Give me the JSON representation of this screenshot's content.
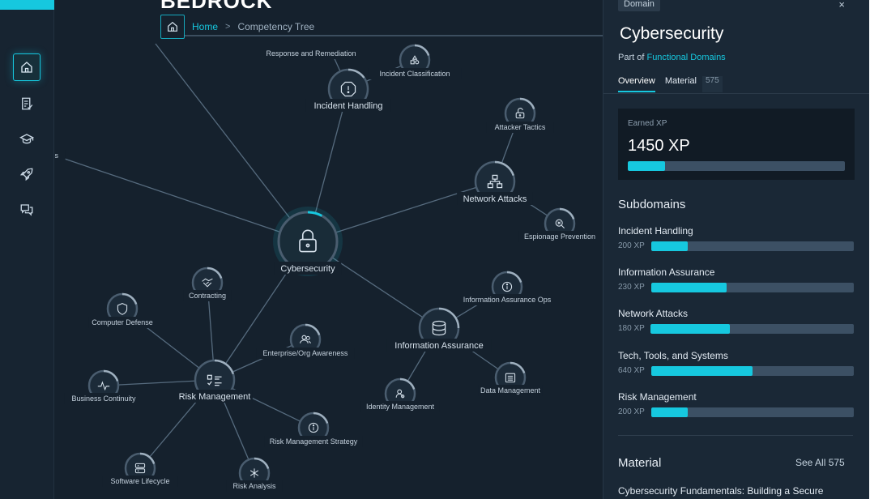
{
  "app": {
    "brand": "BEDROCK"
  },
  "breadcrumb": {
    "home": "Home",
    "separator": ">",
    "current": "Competency Tree"
  },
  "sidebar": {
    "items": [
      {
        "icon": "home-icon",
        "active": true
      },
      {
        "icon": "document-icon",
        "active": false
      },
      {
        "icon": "graduation-cap-icon",
        "active": false
      },
      {
        "icon": "rocket-icon",
        "active": false
      },
      {
        "icon": "chat-icon",
        "active": false
      }
    ]
  },
  "graph": {
    "nodes": [
      {
        "id": "cybersecurity",
        "label": "Cybersecurity",
        "icon": "lock-icon",
        "progress": 0.08,
        "central": true
      },
      {
        "id": "incident-handling",
        "label": "Incident Handling",
        "icon": "alert-icon",
        "progress": 0.15
      },
      {
        "id": "response-remediation",
        "label": "Response and Remediation",
        "icon": "",
        "progress": 0
      },
      {
        "id": "incident-classification",
        "label": "Incident Classification",
        "icon": "shapes-icon",
        "progress": 0.2
      },
      {
        "id": "attacker-tactics",
        "label": "Attacker Tactics",
        "icon": "unlock-icon",
        "progress": 0.2
      },
      {
        "id": "network-attacks",
        "label": "Network Attacks",
        "icon": "network-icon",
        "progress": 0.2
      },
      {
        "id": "espionage-prevention",
        "label": "Espionage Prevention",
        "icon": "search-icon",
        "progress": 0.2
      },
      {
        "id": "information-assurance-ops",
        "label": "Information Assurance Ops",
        "icon": "info-icon",
        "progress": 0.2
      },
      {
        "id": "information-assurance",
        "label": "Information Assurance",
        "icon": "database-icon",
        "progress": 0.25
      },
      {
        "id": "data-management",
        "label": "Data Management",
        "icon": "archive-icon",
        "progress": 0.2
      },
      {
        "id": "identity-management",
        "label": "Identity Management",
        "icon": "user-icon",
        "progress": 0.2
      },
      {
        "id": "enterprise-awareness",
        "label": "Enterprise/Org Awareness",
        "icon": "users-icon",
        "progress": 0.2
      },
      {
        "id": "contracting",
        "label": "Contracting",
        "icon": "handshake-icon",
        "progress": 0.2
      },
      {
        "id": "computer-defense",
        "label": "Computer Defense",
        "icon": "shield-icon",
        "progress": 0.2
      },
      {
        "id": "risk-management",
        "label": "Risk Management",
        "icon": "checklist-icon",
        "progress": 0.2
      },
      {
        "id": "business-continuity",
        "label": "Business Continuity",
        "icon": "pulse-icon",
        "progress": 0.2
      },
      {
        "id": "risk-management-strategy",
        "label": "Risk Management Strategy",
        "icon": "info-icon",
        "progress": 0.2
      },
      {
        "id": "software-lifecycle",
        "label": "Software Lifecycle",
        "icon": "server-icon",
        "progress": 0.2
      },
      {
        "id": "risk-analysis",
        "label": "Risk Analysis",
        "icon": "asterisk-icon",
        "progress": 0.2
      },
      {
        "id": "offscreen-left",
        "label": "ns",
        "icon": "",
        "progress": 0
      }
    ]
  },
  "panel": {
    "chip": "Domain",
    "close": "×",
    "title": "Cybersecurity",
    "part_of_prefix": "Part of ",
    "part_of_link": "Functional Domains",
    "tabs": {
      "overview": "Overview",
      "material": "Material",
      "material_count": "575"
    },
    "xp": {
      "label": "Earned XP",
      "value": "1450 XP",
      "progress": 0.17
    },
    "subdomains_title": "Subdomains",
    "subdomains": [
      {
        "name": "Incident Handling",
        "xp": "200 XP",
        "progress": 0.18
      },
      {
        "name": "Information Assurance",
        "xp": "230 XP",
        "progress": 0.37
      },
      {
        "name": "Network Attacks",
        "xp": "180 XP",
        "progress": 0.39
      },
      {
        "name": "Tech, Tools, and Systems",
        "xp": "640 XP",
        "progress": 0.5
      },
      {
        "name": "Risk Management",
        "xp": "200 XP",
        "progress": 0.18
      }
    ],
    "material_title": "Material",
    "see_all": "See All 575",
    "material_item": "Cybersecurity Fundamentals: Building a Secure"
  },
  "colors": {
    "accent": "#16c8df",
    "background": "#15212d",
    "panel": "#1a2836",
    "track": "#3c5064"
  }
}
